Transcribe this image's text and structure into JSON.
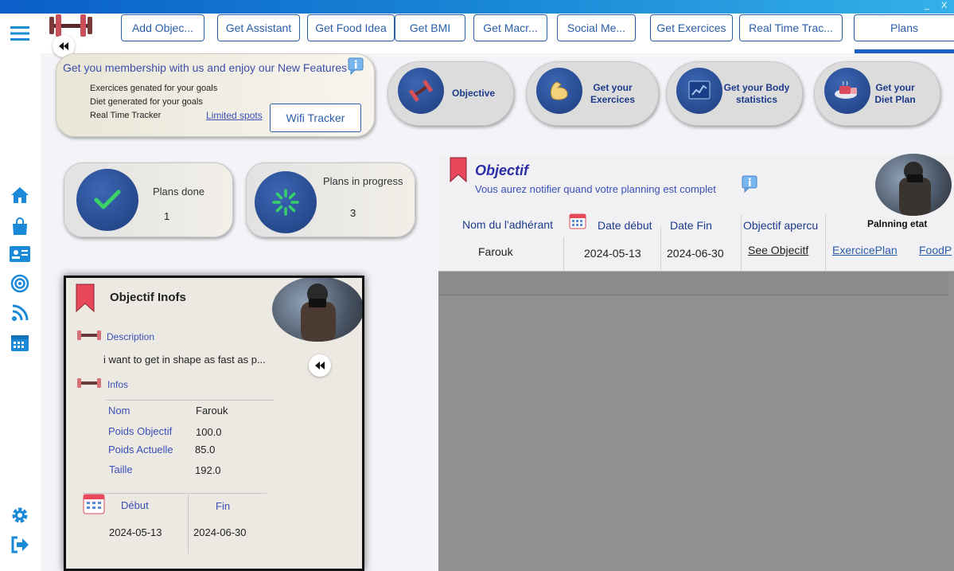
{
  "window": {
    "minimize_glyph": "_",
    "close_glyph": "X"
  },
  "topnav": {
    "buttons": [
      "Add Objec...",
      "Get Assistant",
      "Get Food Idea",
      "Get BMI",
      "Get Macr...",
      "Social Me...",
      "Get Exercices",
      "Real Time Trac...",
      "Plans"
    ]
  },
  "membership": {
    "headline": "Get you membership with us and enjoy our New Features",
    "features": [
      "Exercices genated for your goals",
      "Diet generated for your goals",
      "Real Time Tracker"
    ],
    "limited_link": "Limited spots",
    "wifi_button": "Wifi Tracker"
  },
  "quick_actions": [
    {
      "label": "Objective",
      "icon": "dumbbell-icon"
    },
    {
      "label": "Get your Exercices",
      "icon": "muscle-arm-icon"
    },
    {
      "label": "Get your Body statistics",
      "icon": "chart-icon"
    },
    {
      "label": "Get your Diet Plan",
      "icon": "diet-icon"
    }
  ],
  "stats": {
    "done_label": "Plans done",
    "done_value": "1",
    "progress_label": "Plans in progress",
    "progress_value": "3"
  },
  "objectif": {
    "title": "Objectif",
    "subtitle": "Vous aurez notifier quand votre planning est complet",
    "columns": {
      "member": "Nom du l'adhérant",
      "start": "Date début",
      "end": "Date Fin",
      "preview": "Objectif apercu",
      "state": "Palnning etat"
    },
    "row": {
      "member": "Farouk",
      "start": "2024-05-13",
      "end": "2024-06-30",
      "preview_link": "See Objecitf",
      "exercise_link": "ExercicePlan",
      "food_link": "FoodP"
    }
  },
  "info_card": {
    "title": "Objectif Inofs",
    "description_label": "Description",
    "description": "i want to get in shape as fast as p...",
    "infos_label": "Infos",
    "fields": [
      {
        "key": "Nom",
        "value": "Farouk"
      },
      {
        "key": "Poids Objectif",
        "value": "100.0"
      },
      {
        "key": "Poids Actuelle",
        "value": "85.0"
      },
      {
        "key": "Taille",
        "value": "192.0"
      }
    ],
    "start_label": "Début",
    "end_label": "Fin",
    "start_value": "2024-05-13",
    "end_value": "2024-06-30"
  },
  "colors": {
    "accent": "#2a5ea8",
    "nav_blue": "#1a5fc4",
    "title_bar": "#1a8ad8",
    "link": "#3a4fb8",
    "bookmark_red": "#e8485a"
  }
}
